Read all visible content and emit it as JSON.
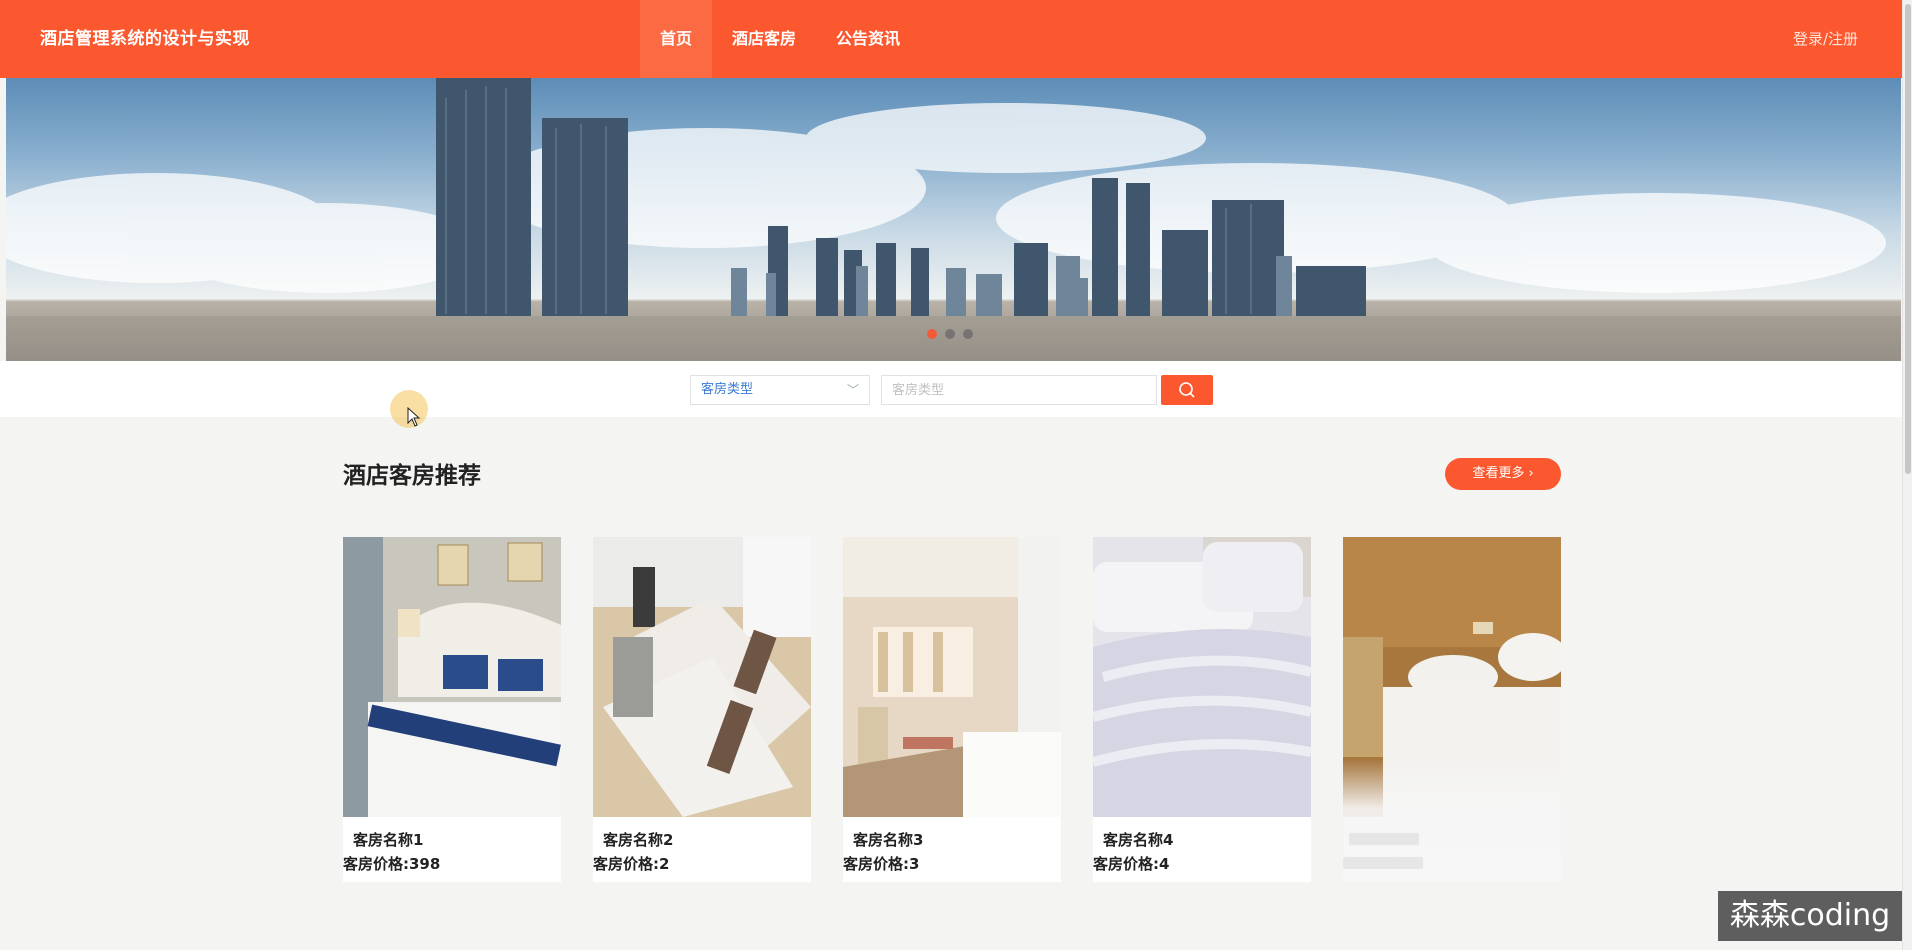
{
  "header": {
    "site_title": "酒店管理系统的设计与实现",
    "nav": [
      {
        "label": "首页",
        "active": true
      },
      {
        "label": "酒店客房",
        "active": false
      },
      {
        "label": "公告资讯",
        "active": false
      }
    ],
    "login_label": "登录/注册"
  },
  "banner": {
    "slides": 3,
    "active_slide": 0
  },
  "search": {
    "select_value": "客房类型",
    "input_placeholder": "客房类型",
    "search_icon": "search-icon"
  },
  "section": {
    "title": "酒店客房推荐",
    "more_label": "查看更多"
  },
  "rooms": [
    {
      "name": "客房名称1",
      "price": "客房价格:398"
    },
    {
      "name": "客房名称2",
      "price": "客房价格:2"
    },
    {
      "name": "客房名称3",
      "price": "客房价格:3"
    },
    {
      "name": "客房名称4",
      "price": "客房价格:4"
    },
    {
      "name": "",
      "price": ""
    }
  ],
  "watermark": "森森coding",
  "colors": {
    "brand": "#fb5830",
    "page_background": "#f4f4f2"
  }
}
